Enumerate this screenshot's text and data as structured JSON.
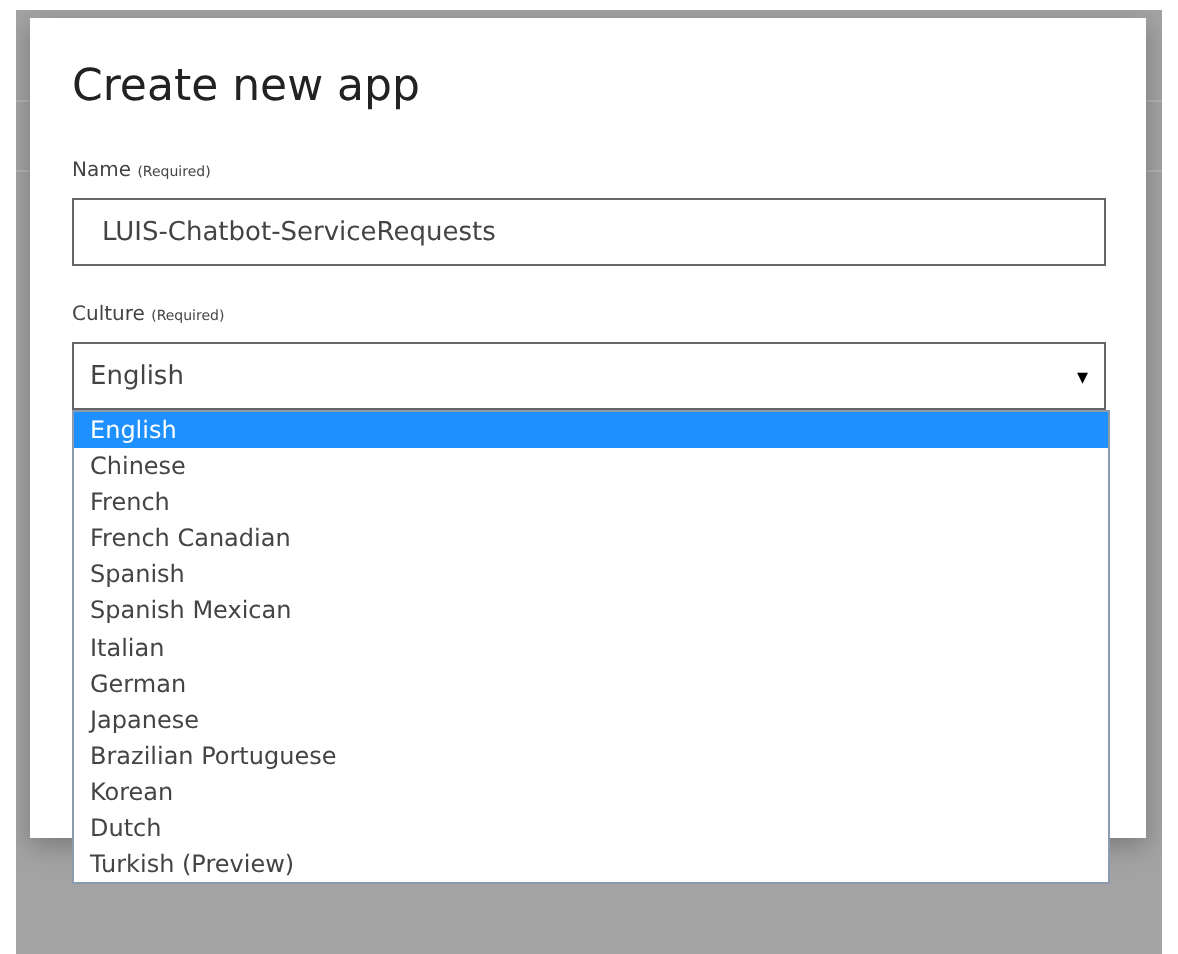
{
  "dialog": {
    "title": "Create new app",
    "name_field": {
      "label": "Name",
      "note": "(Required)",
      "value": "LUIS-Chatbot-ServiceRequests"
    },
    "culture_field": {
      "label": "Culture",
      "note": "(Required)",
      "value": "English",
      "caret": "▾",
      "expanded": true,
      "options": [
        {
          "label": "English",
          "selected": true
        },
        {
          "label": "Chinese",
          "selected": false
        },
        {
          "label": "French",
          "selected": false
        },
        {
          "label": "French Canadian",
          "selected": false
        },
        {
          "label": "Spanish",
          "selected": false
        },
        {
          "label": "Spanish Mexican",
          "selected": false
        },
        {
          "label": "Italian",
          "selected": false
        },
        {
          "label": "German",
          "selected": false
        },
        {
          "label": "Japanese",
          "selected": false
        },
        {
          "label": "Brazilian Portuguese",
          "selected": false
        },
        {
          "label": "Korean",
          "selected": false
        },
        {
          "label": "Dutch",
          "selected": false
        },
        {
          "label": "Turkish (Preview)",
          "selected": false
        }
      ]
    }
  }
}
